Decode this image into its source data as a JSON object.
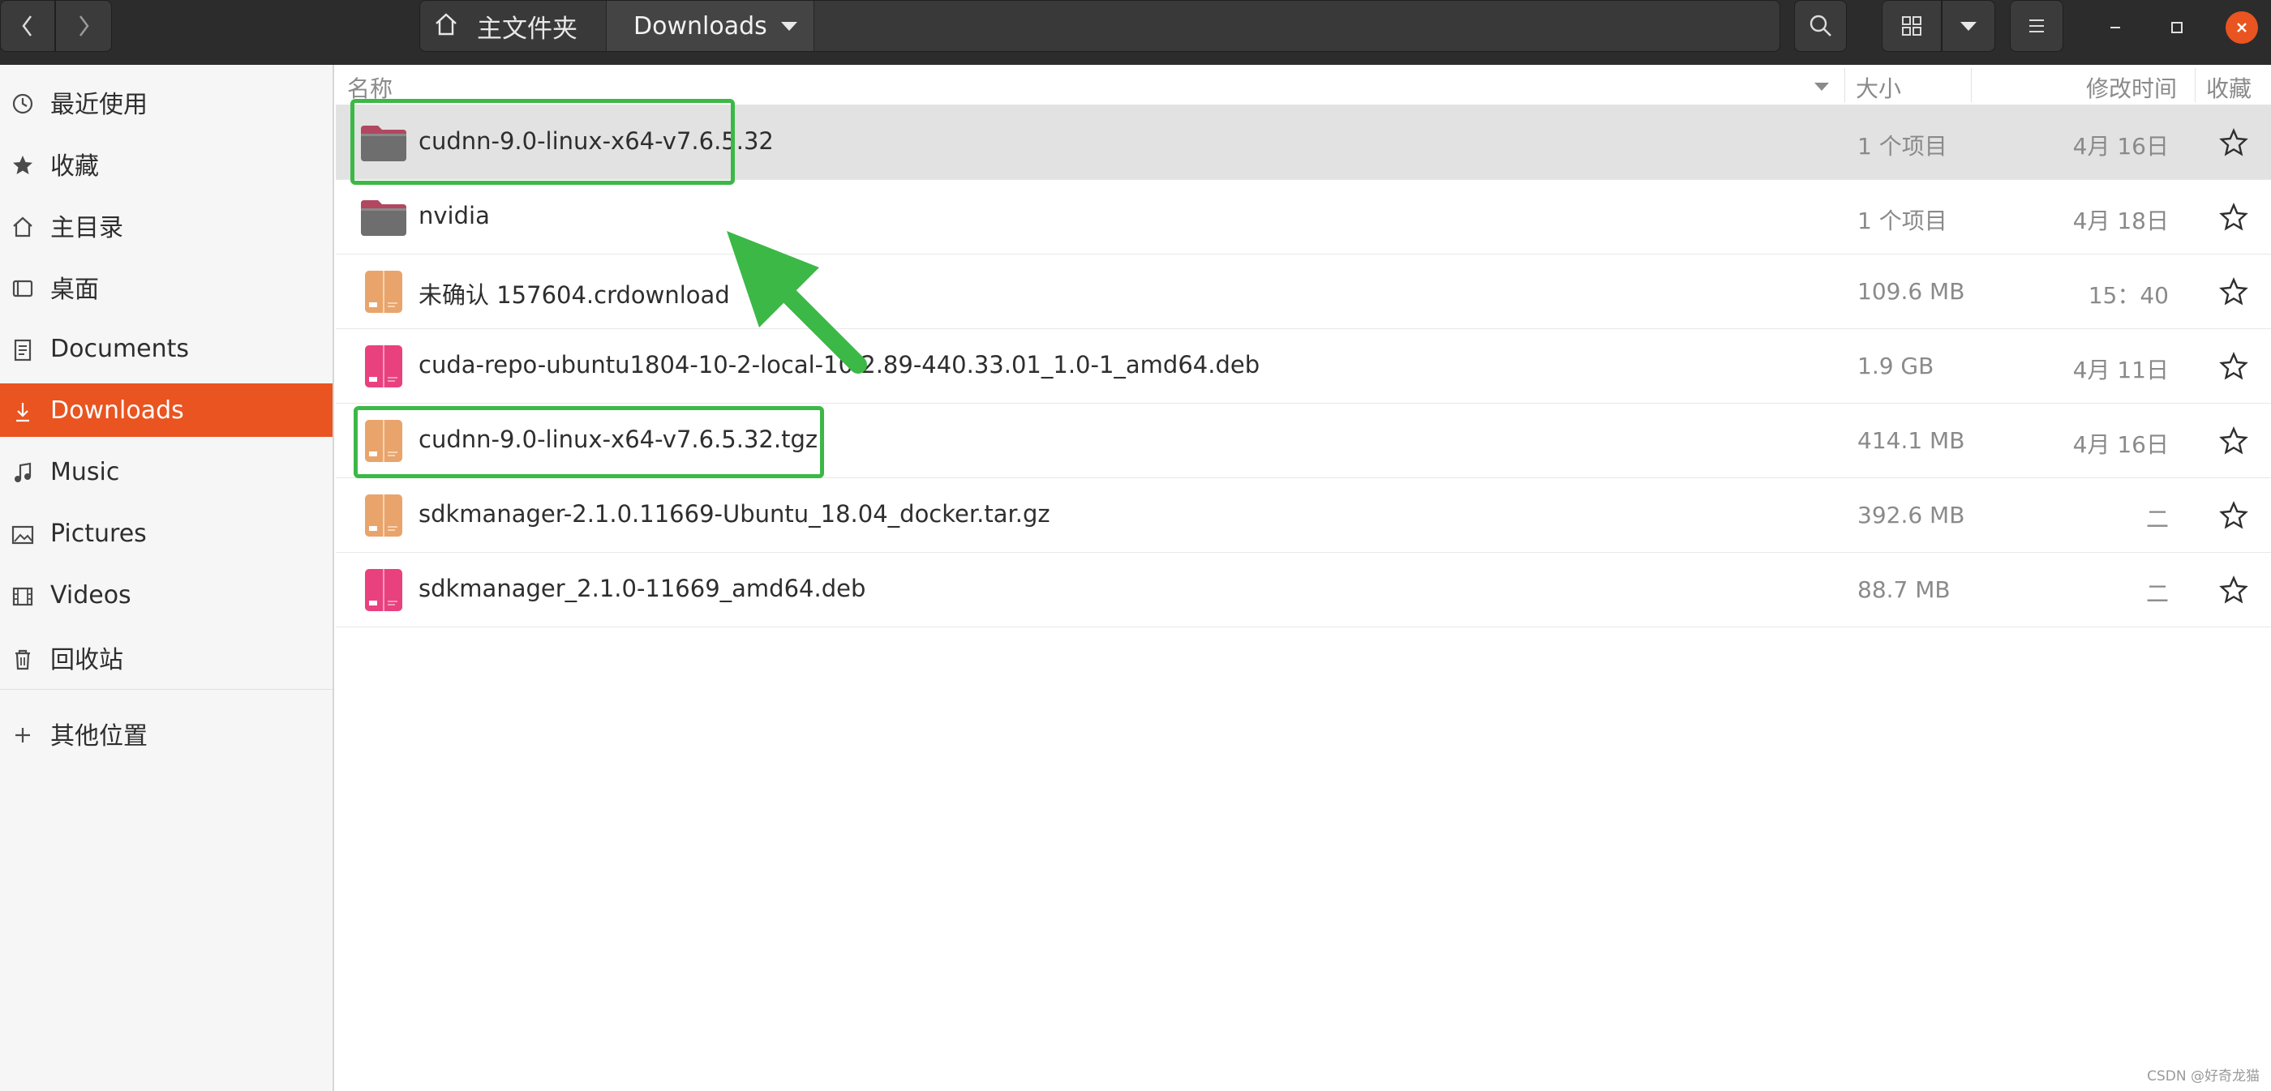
{
  "header": {
    "path": [
      {
        "label": "主文件夹",
        "icon": "home-icon"
      },
      {
        "label": "Downloads",
        "icon": "chevron-down-icon"
      }
    ],
    "icons": [
      "back-icon",
      "forward-icon",
      "search-icon",
      "grid-view-icon",
      "chevron-down-icon",
      "menu-icon",
      "minimize-icon",
      "maximize-icon",
      "close-icon"
    ]
  },
  "sidebar": {
    "items": [
      {
        "label": "最近使用",
        "icon": "recent-icon"
      },
      {
        "label": "收藏",
        "icon": "star-icon"
      },
      {
        "label": "主目录",
        "icon": "home-icon"
      },
      {
        "label": "桌面",
        "icon": "desktop-icon"
      },
      {
        "label": "Documents",
        "icon": "documents-icon"
      },
      {
        "label": "Downloads",
        "icon": "download-icon",
        "active": true
      },
      {
        "label": "Music",
        "icon": "music-icon"
      },
      {
        "label": "Pictures",
        "icon": "pictures-icon"
      },
      {
        "label": "Videos",
        "icon": "videos-icon"
      },
      {
        "label": "回收站",
        "icon": "trash-icon"
      }
    ],
    "other_locations": {
      "label": "其他位置",
      "icon": "plus-icon"
    }
  },
  "columns": {
    "name": "名称",
    "size": "大小",
    "modified": "修改时间",
    "starred": "收藏"
  },
  "files": [
    {
      "name": "cudnn-9.0-linux-x64-v7.6.5.32",
      "size": "1 个项目",
      "modified": "4月 16日",
      "type": "folder",
      "selected": true
    },
    {
      "name": "nvidia",
      "size": "1 个项目",
      "modified": "4月 18日",
      "type": "folder"
    },
    {
      "name": "未确认 157604.crdownload",
      "size": "109.6 MB",
      "modified": "15：40",
      "type": "archive"
    },
    {
      "name": "cuda-repo-ubuntu1804-10-2-local-10.2.89-440.33.01_1.0-1_amd64.deb",
      "size": "1.9 GB",
      "modified": "4月 11日",
      "type": "deb"
    },
    {
      "name": "cudnn-9.0-linux-x64-v7.6.5.32.tgz",
      "size": "414.1 MB",
      "modified": "4月 16日",
      "type": "archive"
    },
    {
      "name": "sdkmanager-2.1.0.11669-Ubuntu_18.04_docker.tar.gz",
      "size": "392.6 MB",
      "modified": "二",
      "type": "archive"
    },
    {
      "name": "sdkmanager_2.1.0-11669_amd64.deb",
      "size": "88.7 MB",
      "modified": "二",
      "type": "deb"
    }
  ],
  "colors": {
    "accent": "#e95420",
    "annotation": "#3cb847",
    "headerbar": "#2c2c2c"
  },
  "watermark": "CSDN @好奇龙猫"
}
